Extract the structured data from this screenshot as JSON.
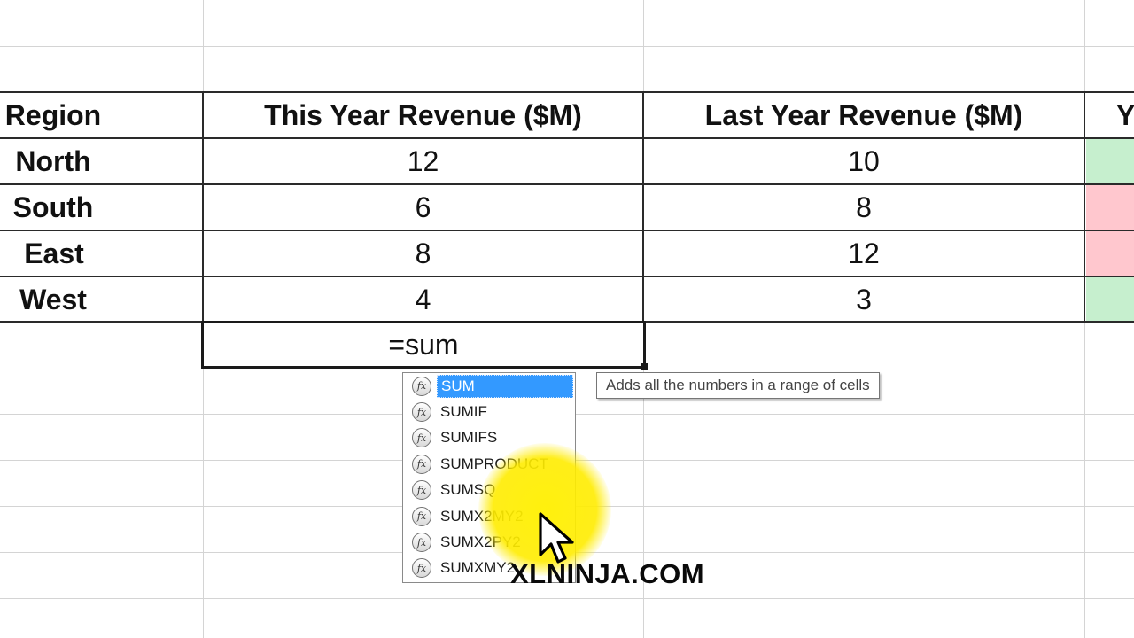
{
  "table": {
    "headers": {
      "region": "Region",
      "this_year": "This Year Revenue ($M)",
      "last_year": "Last Year Revenue ($M)",
      "partial": "Y"
    },
    "rows": [
      {
        "region": "North",
        "this_year": "12",
        "last_year": "10",
        "status_color": "#c6efce"
      },
      {
        "region": "South",
        "this_year": "6",
        "last_year": "8",
        "status_color": "#ffc7ce"
      },
      {
        "region": "East",
        "this_year": "8",
        "last_year": "12",
        "status_color": "#ffc7ce"
      },
      {
        "region": "West",
        "this_year": "4",
        "last_year": "3",
        "status_color": "#c6efce"
      }
    ]
  },
  "editing_cell": {
    "value": "=sum"
  },
  "autocomplete": {
    "icon": "function-fx-icon",
    "icon_glyph": "fx",
    "items": [
      "SUM",
      "SUMIF",
      "SUMIFS",
      "SUMPRODUCT",
      "SUMSQ",
      "SUMX2MY2",
      "SUMX2PY2",
      "SUMXMY2"
    ],
    "selected": "SUM"
  },
  "tooltip": {
    "text": "Adds all the numbers in a range of cells"
  },
  "watermark": {
    "text": "XLNINJA.COM"
  },
  "colors": {
    "selection": "#3399ff",
    "good": "#c6efce",
    "bad": "#ffc7ce",
    "highlight": "#ffee00"
  }
}
